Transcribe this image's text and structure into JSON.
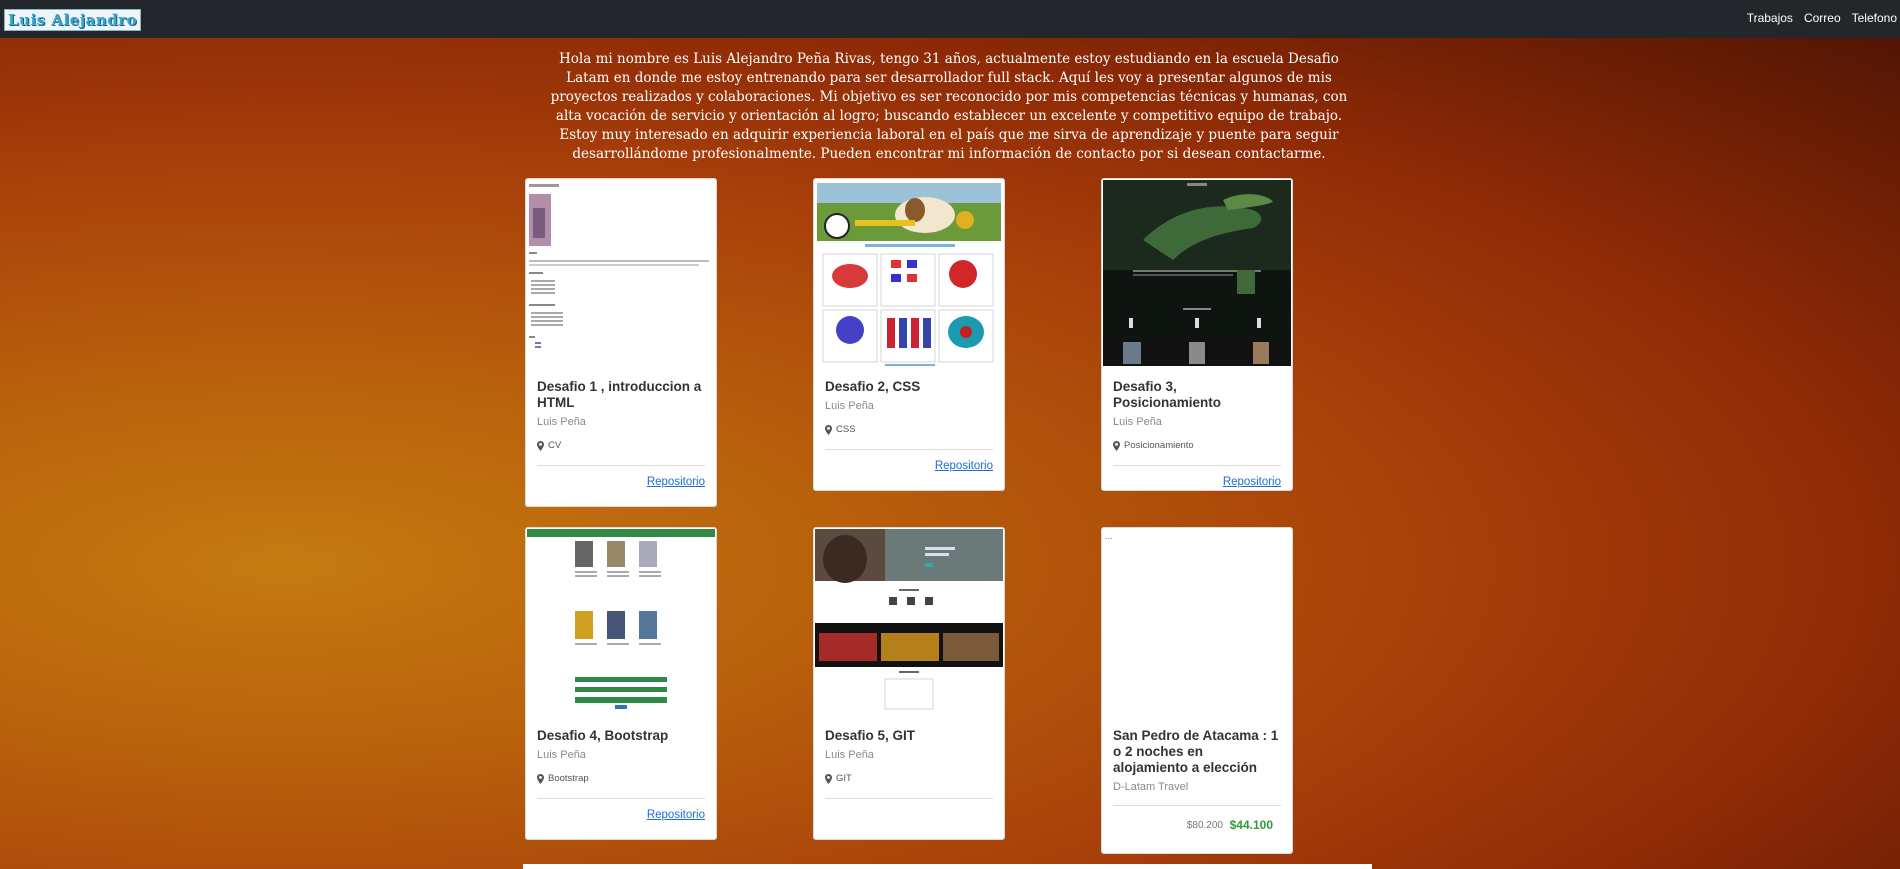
{
  "navbar": {
    "brand": "Luis Alejandro",
    "links": [
      "Trabajos",
      "Correo",
      "Telefono"
    ]
  },
  "intro": "Hola mi nombre es Luis Alejandro Peña Rivas, tengo 31 años, actualmente estoy estudiando en la escuela Desafio Latam en donde me estoy entrenando para ser desarrollador full stack. Aquí les voy a presentar algunos de mis proyectos realizados y colaboraciones. Mi objetivo es ser reconocido por mis competencias técnicas y humanas, con alta vocación de servicio y orientación al logro; buscando establecer un excelente y competitivo equipo de trabajo. Estoy muy interesado en adquirir experiencia laboral en el país que me sirva de aprendizaje y puente para seguir desarrollándome profesionalmente. Pueden encontrar mi información de contacto por si desean contactarme.",
  "cards": [
    {
      "title": "Desafio 1 , introduccion a HTML",
      "subtitle": "Luis Peña",
      "location": "CV",
      "link": "Repositorio"
    },
    {
      "title": "Desafio 2, CSS",
      "subtitle": "Luis Peña",
      "location": "CSS",
      "link": "Repositorio"
    },
    {
      "title": "Desafio 3, Posicionamiento",
      "subtitle": "Luis Peña",
      "location": "Posicionamiento",
      "link": "Repositorio"
    },
    {
      "title": "Desafio 4, Bootstrap",
      "subtitle": "Luis Peña",
      "location": "Bootstrap",
      "link": "Repositorio"
    },
    {
      "title": "Desafio 5, GIT",
      "subtitle": "Luis Peña",
      "location": "GIT",
      "link": ""
    },
    {
      "title": "San Pedro de Atacama : 1 o 2 noches en alojamiento a elección",
      "subtitle": "D-Latam Travel",
      "price_old": "$80.200",
      "price_new": "$44.100",
      "image_alt": "..."
    }
  ],
  "colors": {
    "navbar": "#23272b",
    "link": "#1a6ed8",
    "price": "#2f9a3c"
  },
  "icons": [
    "map-marker-icon"
  ]
}
